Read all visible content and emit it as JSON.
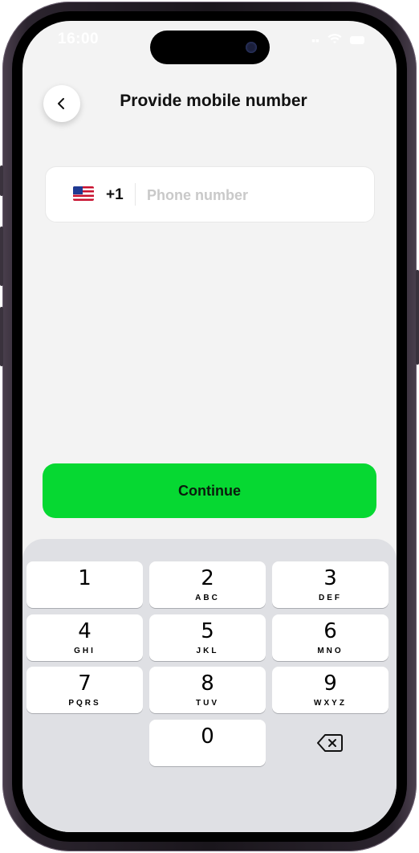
{
  "status_bar": {
    "time": "16:00"
  },
  "header": {
    "title": "Provide mobile number"
  },
  "phone": {
    "dial_code": "+1",
    "placeholder": "Phone number",
    "value": ""
  },
  "cta": {
    "label": "Continue"
  },
  "keypad": {
    "keys": [
      {
        "num": "1",
        "letters": ""
      },
      {
        "num": "2",
        "letters": "ABC"
      },
      {
        "num": "3",
        "letters": "DEF"
      },
      {
        "num": "4",
        "letters": "GHI"
      },
      {
        "num": "5",
        "letters": "JKL"
      },
      {
        "num": "6",
        "letters": "MNO"
      },
      {
        "num": "7",
        "letters": "PQRS"
      },
      {
        "num": "8",
        "letters": "TUV"
      },
      {
        "num": "9",
        "letters": "WXYZ"
      },
      {
        "num": "0",
        "letters": ""
      }
    ]
  },
  "colors": {
    "accent": "#06d832",
    "screen_bg": "#f3f3f3",
    "keypad_bg": "#dfe0e4"
  },
  "icons": {
    "back": "chevron-left-icon",
    "delete": "backspace-icon",
    "flag": "us-flag-icon"
  }
}
